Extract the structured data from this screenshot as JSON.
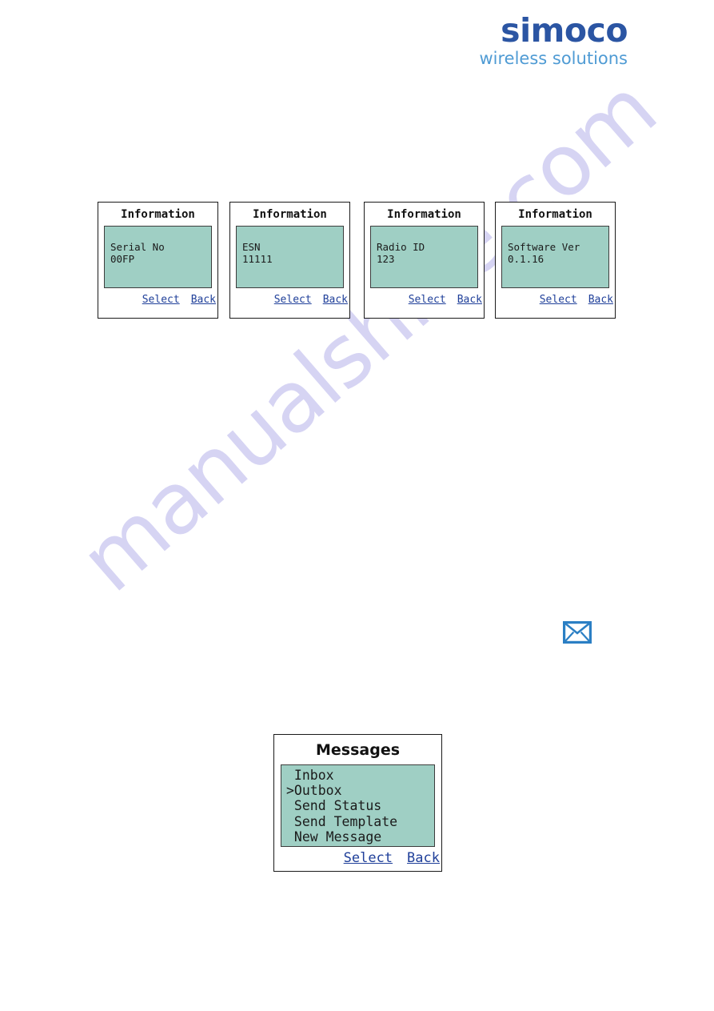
{
  "brand": {
    "name": "simoco",
    "tagline": "wireless solutions",
    "primary_color": "#2b55a3",
    "secondary_color": "#4f9bd4"
  },
  "watermark": {
    "text": "manualshive.com",
    "color": "#cfcdf2"
  },
  "lcd_theme": {
    "screen_background": "#9fcfc4",
    "text_color": "#1b1b1b",
    "softkey_color": "#20409a",
    "border_color": "#1a1a1a"
  },
  "icons": {
    "envelope": {
      "name": "envelope-icon",
      "color": "#2b7fc4"
    }
  },
  "softkeys": {
    "select_label": "Select",
    "back_label": "Back"
  },
  "info_panels": [
    {
      "title": "Information",
      "label": "Serial No",
      "value": "00FP",
      "select_label": "Select",
      "back_label": "Back"
    },
    {
      "title": "Information",
      "label": "ESN",
      "value": "11111",
      "select_label": "Select",
      "back_label": "Back"
    },
    {
      "title": "Information",
      "label": "Radio ID",
      "value": "123",
      "select_label": "Select",
      "back_label": "Back"
    },
    {
      "title": "Information",
      "label": "Software Ver",
      "value": "0.1.16",
      "select_label": "Select",
      "back_label": "Back"
    }
  ],
  "messages_panel": {
    "title": "Messages",
    "select_label": "Select",
    "back_label": "Back",
    "cursor": ">",
    "items": [
      {
        "label": "Inbox",
        "selected": false,
        "prefix": " "
      },
      {
        "label": "Outbox",
        "selected": true,
        "prefix": ">"
      },
      {
        "label": "Send Status",
        "selected": false,
        "prefix": " "
      },
      {
        "label": "Send Template",
        "selected": false,
        "prefix": " "
      },
      {
        "label": "New Message",
        "selected": false,
        "prefix": " "
      }
    ]
  }
}
